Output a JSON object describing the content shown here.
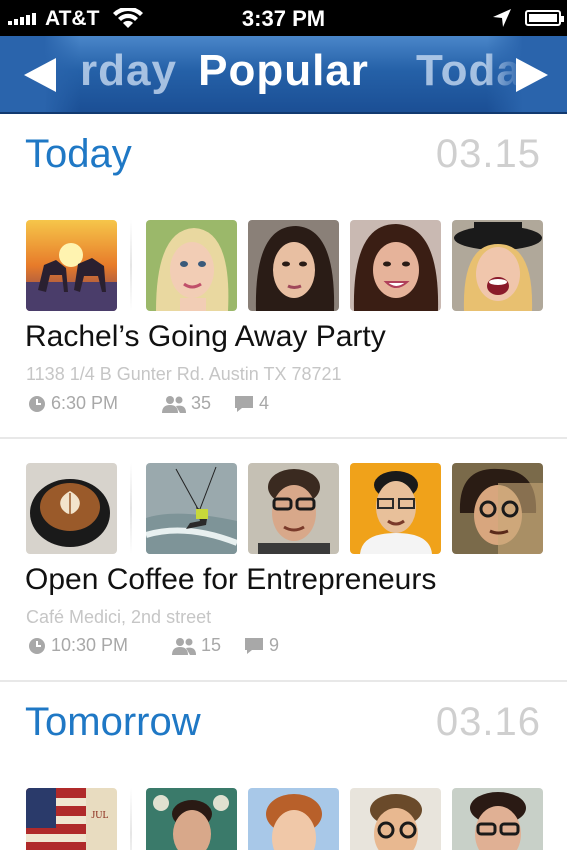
{
  "status_bar": {
    "carrier": "AT&T",
    "time": "3:37 PM"
  },
  "nav": {
    "prev_label": "rday",
    "title": "Popular",
    "next_label": "Toda",
    "bar_color": "#2561a8"
  },
  "sections": [
    {
      "title": "Today",
      "date": "03.15"
    },
    {
      "title": "Tomorrow",
      "date": "03.16"
    }
  ],
  "events": [
    {
      "title": "Rachel’s Going Away Party",
      "address": "1138 1/4 B Gunter Rd. Austin TX 78721",
      "time": "6:30 PM",
      "attendees": "35",
      "comments": "4",
      "thumbnails": [
        "unicorn-painting-photo",
        "blonde-woman-photo",
        "dark-hair-woman-photo",
        "smiling-woman-photo",
        "woman-with-hat-photo"
      ]
    },
    {
      "title": "Open Coffee for Entrepreneurs",
      "address": "Café Medici, 2nd street",
      "time": "10:30 PM",
      "attendees": "15",
      "comments": "9",
      "thumbnails": [
        "latte-art-photo",
        "kitesurfer-photo",
        "man-glasses-photo",
        "man-yellow-background-photo",
        "man-illustrated-photo"
      ]
    }
  ],
  "colors": {
    "accent": "#1f78c5",
    "date_gray": "#cfcfcf",
    "meta_gray": "#a8a8a8"
  }
}
